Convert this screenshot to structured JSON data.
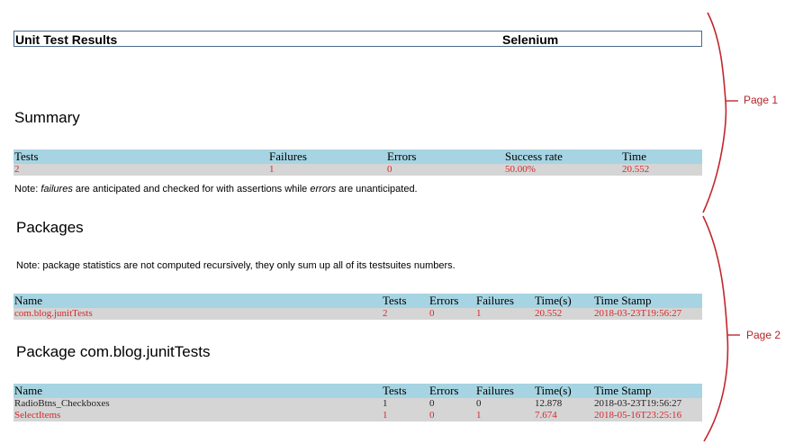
{
  "header": {
    "title": "Unit Test Results",
    "project": "Selenium"
  },
  "summary": {
    "heading": "Summary",
    "columns": [
      "Tests",
      "Failures",
      "Errors",
      "Success rate",
      "Time"
    ],
    "row": [
      "2",
      "1",
      "0",
      "50.00%",
      "20.552"
    ],
    "note_prefix": "Note: ",
    "note_em1": "failures",
    "note_mid": " are anticipated and checked for with assertions while ",
    "note_em2": "errors",
    "note_suffix": " are unanticipated."
  },
  "packages": {
    "heading": "Packages",
    "note": "Note: package statistics are not computed recursively, they only sum up all of its testsuites numbers.",
    "columns": [
      "Name",
      "Tests",
      "Errors",
      "Failures",
      "Time(s)",
      "Time Stamp"
    ],
    "rows": [
      [
        "com.blog.junitTests",
        "2",
        "0",
        "1",
        "20.552",
        "2018-03-23T19:56:27"
      ]
    ]
  },
  "package_detail": {
    "heading": "Package com.blog.junitTests",
    "columns": [
      "Name",
      "Tests",
      "Errors",
      "Failures",
      "Time(s)",
      "Time Stamp"
    ],
    "rows": [
      [
        "RadioBtns_Checkboxes",
        "1",
        "0",
        "0",
        "12.878",
        "2018-03-23T19:56:27"
      ],
      [
        "SelectItems",
        "1",
        "0",
        "1",
        "7.674",
        "2018-05-16T23:25:16"
      ]
    ]
  },
  "annotations": {
    "page1": "Page 1",
    "page2": "Page 2"
  },
  "colors": {
    "table_header": "#a6d4e2",
    "table_row": "#d5d5d5",
    "failure_text": "#d6282c",
    "annotation": "#b0252b"
  }
}
